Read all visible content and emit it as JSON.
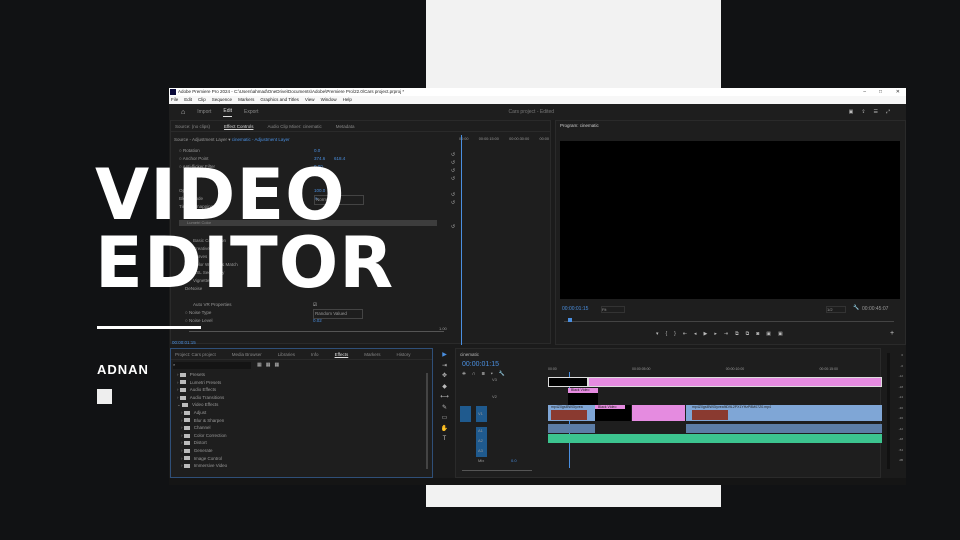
{
  "overlay": {
    "title_line1": "VIDEO",
    "title_line2": "EDITOR",
    "author": "ADNAN"
  },
  "app": {
    "window_title": "Adobe Premiere Pro 2024 - C:\\Users\\ahmad\\OneDrive\\Documents\\Adobe\\Premiere Pro\\22.0\\Cars project.prproj *",
    "menu": [
      "File",
      "Edit",
      "Clip",
      "Sequence",
      "Markers",
      "Graphics and Titles",
      "View",
      "Window",
      "Help"
    ],
    "workspace_tabs": [
      "Import",
      "Edit",
      "Export"
    ],
    "project_status": "Cars project - Edited",
    "source_tabs": [
      "Source: (no clips)",
      "Effect Controls",
      "Audio Clip Mixer: cinematic",
      "Metadata"
    ],
    "source_label": "Source - Adjustment Layer",
    "clip_label": "cinematic - Adjustment Layer",
    "ec_ruler": [
      "00:00",
      "00:00:15:00",
      "00:00:30:00",
      "00:00"
    ],
    "properties": [
      {
        "name": "Rotation",
        "value": "0.0"
      },
      {
        "name": "Anchor Point",
        "value": "374.6",
        "value2": "618.4"
      },
      {
        "name": "Anti-flicker Filter",
        "value": "0.00"
      },
      {
        "name": "Opacity",
        "value": "100.0 %"
      },
      {
        "name": "Blend Mode",
        "value": "Normal"
      },
      {
        "name": "Time Remapping",
        "value": ""
      },
      {
        "name": "Lumetri Color",
        "value": ""
      },
      {
        "name": "Basic Correction",
        "value": ""
      },
      {
        "name": "Creative",
        "value": ""
      },
      {
        "name": "Curves",
        "value": ""
      },
      {
        "name": "Color Wheels & Match",
        "value": ""
      },
      {
        "name": "HSL Secondary",
        "value": ""
      },
      {
        "name": "Vignette",
        "value": ""
      },
      {
        "name": "DeNoise",
        "value": ""
      },
      {
        "name": "Auto VR Properties",
        "value": ""
      },
      {
        "name": "Noise Type",
        "value": "Random Valued"
      },
      {
        "name": "Noise Level",
        "value": "0.02"
      }
    ],
    "slider_max": "1.00",
    "ec_timecode": "00:00:01:15",
    "program": {
      "title": "Program: cinematic",
      "timecode": "00:00:01:15",
      "fit": "Fit",
      "resolution": "1/2",
      "duration": "00:00:45:07"
    },
    "project_tabs": [
      "Project: Cars project",
      "Media Browser",
      "Libraries",
      "Info",
      "Effects",
      "Markers",
      "History"
    ],
    "effects_tree": [
      "Presets",
      "Lumetri Presets",
      "Audio Effects",
      "Audio Transitions",
      "Video Effects",
      "Adjust",
      "Blur & Sharpen",
      "Channel",
      "Color Correction",
      "Distort",
      "Generate",
      "Image Control",
      "Immersive Video"
    ],
    "timeline": {
      "sequence": "cinematic",
      "timecode": "00:00:01:15",
      "ruler": [
        "00:00",
        "00:00:05:00",
        "00:00:10:00",
        "00:00:15:00"
      ],
      "tracks": [
        "V3",
        "V2",
        "V1",
        "A1",
        "A2",
        "A3",
        "Mix"
      ],
      "mix_value": "0.0",
      "clips": {
        "black1": "Black Video",
        "black2": "Black Video",
        "v1a": "mp4Z0gsI5WGlyvea",
        "v1b": "mp4Z0gsI5WGlyvea9iD9L2PX1YHzP8M07Z0.mp4"
      }
    },
    "meter_scale": [
      "0",
      "-6",
      "-12",
      "-18",
      "-24",
      "-30",
      "-36",
      "-42",
      "-48",
      "-54",
      "dB"
    ],
    "colors": {
      "accent": "#4a8fe0",
      "adjustment": "#e58be0",
      "video": "#7fa6d6",
      "audio": "#3cc48f"
    }
  }
}
